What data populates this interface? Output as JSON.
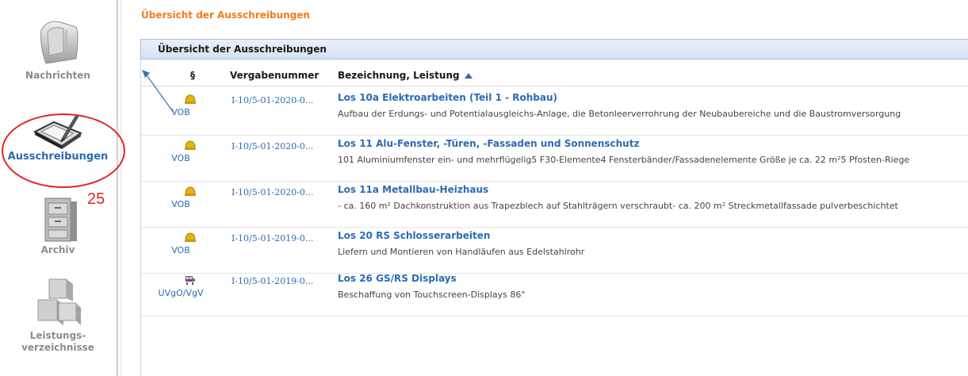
{
  "sidebar": {
    "items": [
      {
        "label": "Nachrichten",
        "icon": "mailbox-icon"
      },
      {
        "label": "Ausschreibungen",
        "icon": "tablet-pen-icon"
      },
      {
        "label": "Archiv",
        "icon": "file-cabinet-icon"
      },
      {
        "label_line1": "Leistungs-",
        "label_line2": "verzeichnisse",
        "icon": "boxes-icon"
      }
    ],
    "annotation_number": "25"
  },
  "breadcrumb": "Übersicht der Ausschreibungen",
  "panel": {
    "title": "Übersicht der Ausschreibungen",
    "columns": [
      "§",
      "Vergabenummer",
      "Bezeichnung, Leistung"
    ]
  },
  "rows": [
    {
      "type": "VOB",
      "number": "I-10/5-01-2020-0...",
      "title": "Los 10a Elektroarbeiten (Teil 1 - Rohbau)",
      "description": "Aufbau der Erdungs- und Potentialausgleichs-Anlage, die Betonleerverrohrung der Neubaubereiche und die Baustromversorgung"
    },
    {
      "type": "VOB",
      "number": "I-10/5-01-2020-0...",
      "title": "Los 11 Alu-Fenster, -Türen, -Fassaden und Sonnenschutz",
      "description": "101 Aluminiumfenster ein- und mehrflügelig5 F30-Elemente4 Fensterbänder/Fassadenelemente Größe je ca. 22 m²5 Pfosten-Riege"
    },
    {
      "type": "VOB",
      "number": "I-10/5-01-2020-0...",
      "title": "Los 11a Metallbau-Heizhaus",
      "description": "- ca. 160 m² Dachkonstruktion aus Trapezblech auf Stahlträgern verschraubt- ca. 200 m² Streckmetallfassade pulverbeschichtet"
    },
    {
      "type": "VOB",
      "number": "I-10/5-01-2019-0...",
      "title": "Los 20 RS Schlosserarbeiten",
      "description": "Liefern und Montieren von Handläufen aus Edelstahlrohr"
    },
    {
      "type": "UVgO/VgV",
      "number": "I-10/5-01-2019-0...",
      "title": "Los 26 GS/RS Displays",
      "description": "Beschaffung von Touchscreen-Displays 86\""
    }
  ],
  "colors": {
    "accent": "#2b6bb3",
    "breadcrumb": "#f07c1a",
    "annotation": "#e42323"
  }
}
